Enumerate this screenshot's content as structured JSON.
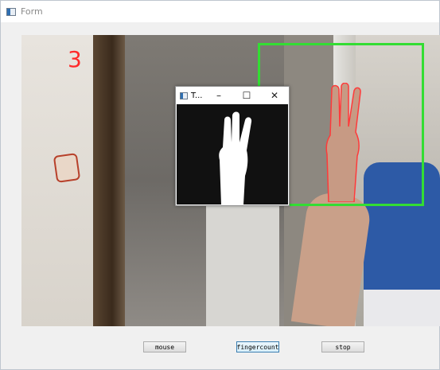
{
  "window": {
    "title": "Form"
  },
  "video": {
    "finger_count": "3"
  },
  "popup": {
    "title": "T...",
    "minimize_glyph": "–",
    "maximize_glyph": "☐",
    "close_glyph": "✕"
  },
  "buttons": {
    "mouse": "mouse",
    "fingercount": "fingercount",
    "stop": "stop"
  },
  "colors": {
    "count_text": "#ff2a2a",
    "roi_box": "#33dd33",
    "mask_bg": "#111111",
    "mask_fg": "#ffffff"
  }
}
